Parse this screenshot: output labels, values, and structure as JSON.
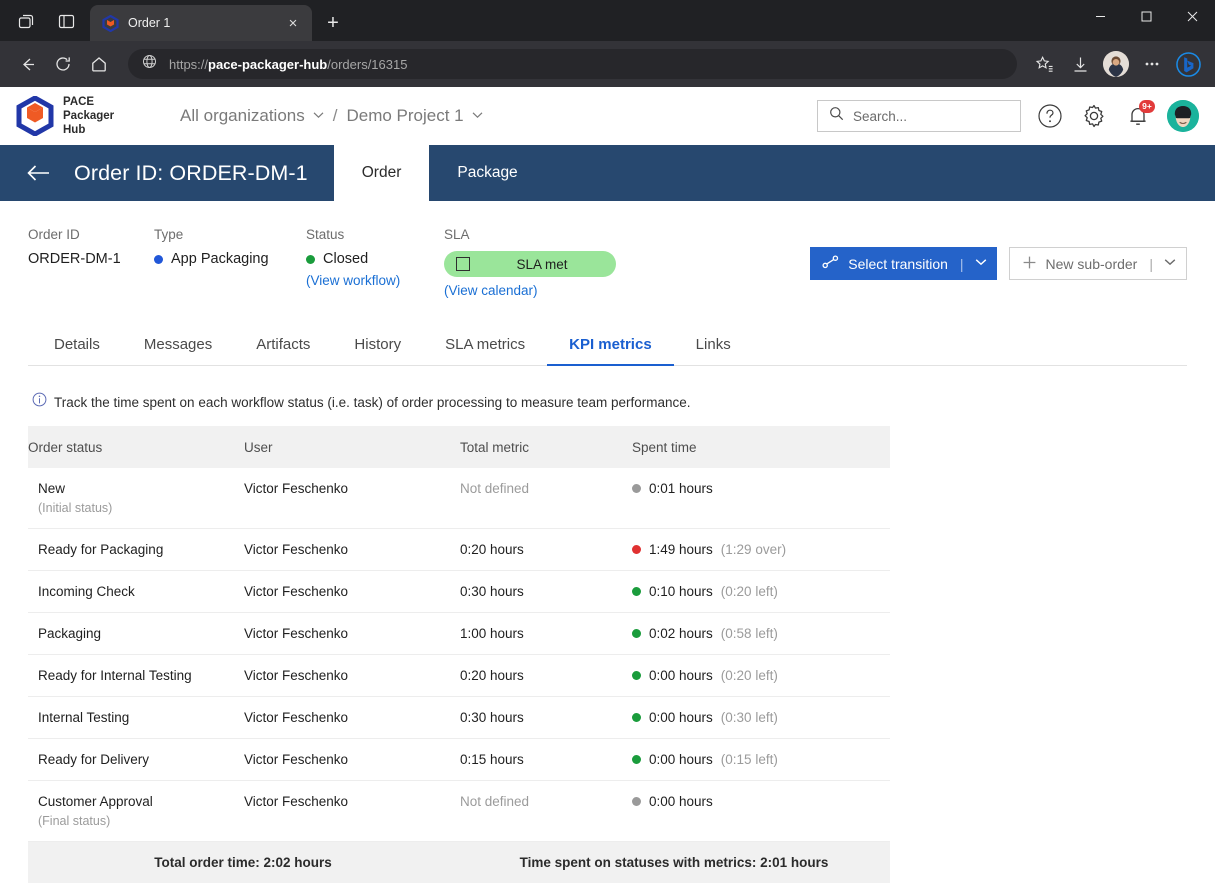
{
  "browser": {
    "tab": {
      "title": "Order 1",
      "favicon": "pace-cube-icon",
      "close_label": "×"
    },
    "new_tab_label": "+",
    "window_controls": {
      "minimize": "—",
      "maximize": "☐",
      "close": "✕"
    },
    "nav": {
      "back": "←",
      "reload": "↻",
      "home": "⌂"
    },
    "url": {
      "scheme": "https://",
      "host": "pace-packager-hub",
      "path": "/orders/16315"
    },
    "actions": {
      "favorites": "favorites-icon",
      "downloads": "downloads-icon",
      "profile": "profile-avatar",
      "more": "···",
      "copilot": "bing-copilot-icon"
    }
  },
  "app": {
    "logo": {
      "line1": "PACE",
      "line2": "Packager",
      "line3": "Hub"
    },
    "breadcrumbs": [
      {
        "label": "All organizations",
        "caret": "⌄"
      },
      {
        "label": "Demo Project 1",
        "caret": "⌄"
      }
    ],
    "breadcrumb_separator": "/",
    "search": {
      "placeholder": "Search...",
      "value": ""
    },
    "help_label": "?",
    "settings_label": "gear-icon",
    "notifications": {
      "count": "9+"
    },
    "order_bar": {
      "back": "←",
      "title": "Order ID: ORDER-DM-1",
      "tabs": [
        {
          "label": "Order",
          "active": true
        },
        {
          "label": "Package",
          "active": false
        }
      ]
    },
    "meta": {
      "order_id": {
        "label": "Order ID",
        "value": "ORDER-DM-1"
      },
      "type": {
        "label": "Type",
        "value": "App Packaging",
        "color": "#2157d8"
      },
      "status": {
        "label": "Status",
        "value": "Closed",
        "color": "#1a9c3c",
        "link": "(View workflow)"
      },
      "sla": {
        "label": "SLA",
        "chip": "SLA met",
        "chip_bg": "#9ae59a",
        "link": "(View calendar)"
      }
    },
    "actions": {
      "select_transition": {
        "label": "Select transition",
        "divider": "|",
        "caret": "⌄",
        "color": "#2563c9"
      },
      "new_sub_order": {
        "label": "New sub-order",
        "plus": "+",
        "divider": "|",
        "caret": "⌄"
      }
    },
    "tabs": [
      {
        "label": "Details",
        "active": false
      },
      {
        "label": "Messages",
        "active": false
      },
      {
        "label": "Artifacts",
        "active": false
      },
      {
        "label": "History",
        "active": false
      },
      {
        "label": "SLA metrics",
        "active": false
      },
      {
        "label": "KPI metrics",
        "active": true
      },
      {
        "label": "Links",
        "active": false
      }
    ],
    "active_tab_color": "#1a5fd0",
    "info_note": "Track the time spent on each workflow status (i.e. task) of order processing to measure team performance.",
    "table": {
      "columns": [
        "Order status",
        "User",
        "Total metric",
        "Spent time"
      ],
      "rows": [
        {
          "status": "New",
          "note": "(Initial status)",
          "user": "Victor Feschenko",
          "metric": "Not defined",
          "metric_muted": true,
          "dot": "#9a9a9a",
          "spent": "0:01 hours",
          "extra": ""
        },
        {
          "status": "Ready for Packaging",
          "note": "",
          "user": "Victor Feschenko",
          "metric": "0:20 hours",
          "metric_muted": false,
          "dot": "#e03131",
          "spent": "1:49 hours",
          "extra": "(1:29 over)"
        },
        {
          "status": "Incoming Check",
          "note": "",
          "user": "Victor Feschenko",
          "metric": "0:30 hours",
          "metric_muted": false,
          "dot": "#1a9c3c",
          "spent": "0:10 hours",
          "extra": "(0:20 left)"
        },
        {
          "status": "Packaging",
          "note": "",
          "user": "Victor Feschenko",
          "metric": "1:00 hours",
          "metric_muted": false,
          "dot": "#1a9c3c",
          "spent": "0:02 hours",
          "extra": "(0:58 left)"
        },
        {
          "status": "Ready for Internal Testing",
          "note": "",
          "user": "Victor Feschenko",
          "metric": "0:20 hours",
          "metric_muted": false,
          "dot": "#1a9c3c",
          "spent": "0:00 hours",
          "extra": "(0:20 left)"
        },
        {
          "status": "Internal Testing",
          "note": "",
          "user": "Victor Feschenko",
          "metric": "0:30 hours",
          "metric_muted": false,
          "dot": "#1a9c3c",
          "spent": "0:00 hours",
          "extra": "(0:30 left)"
        },
        {
          "status": "Ready for Delivery",
          "note": "",
          "user": "Victor Feschenko",
          "metric": "0:15 hours",
          "metric_muted": false,
          "dot": "#1a9c3c",
          "spent": "0:00 hours",
          "extra": "(0:15 left)"
        },
        {
          "status": "Customer Approval",
          "note": "(Final status)",
          "user": "Victor Feschenko",
          "metric": "Not defined",
          "metric_muted": true,
          "dot": "#9a9a9a",
          "spent": "0:00 hours",
          "extra": ""
        }
      ],
      "footer": {
        "total_order_time": "Total order time: 2:02 hours",
        "time_spent_with_metrics": "Time spent on statuses with metrics: 2:01 hours"
      }
    }
  }
}
